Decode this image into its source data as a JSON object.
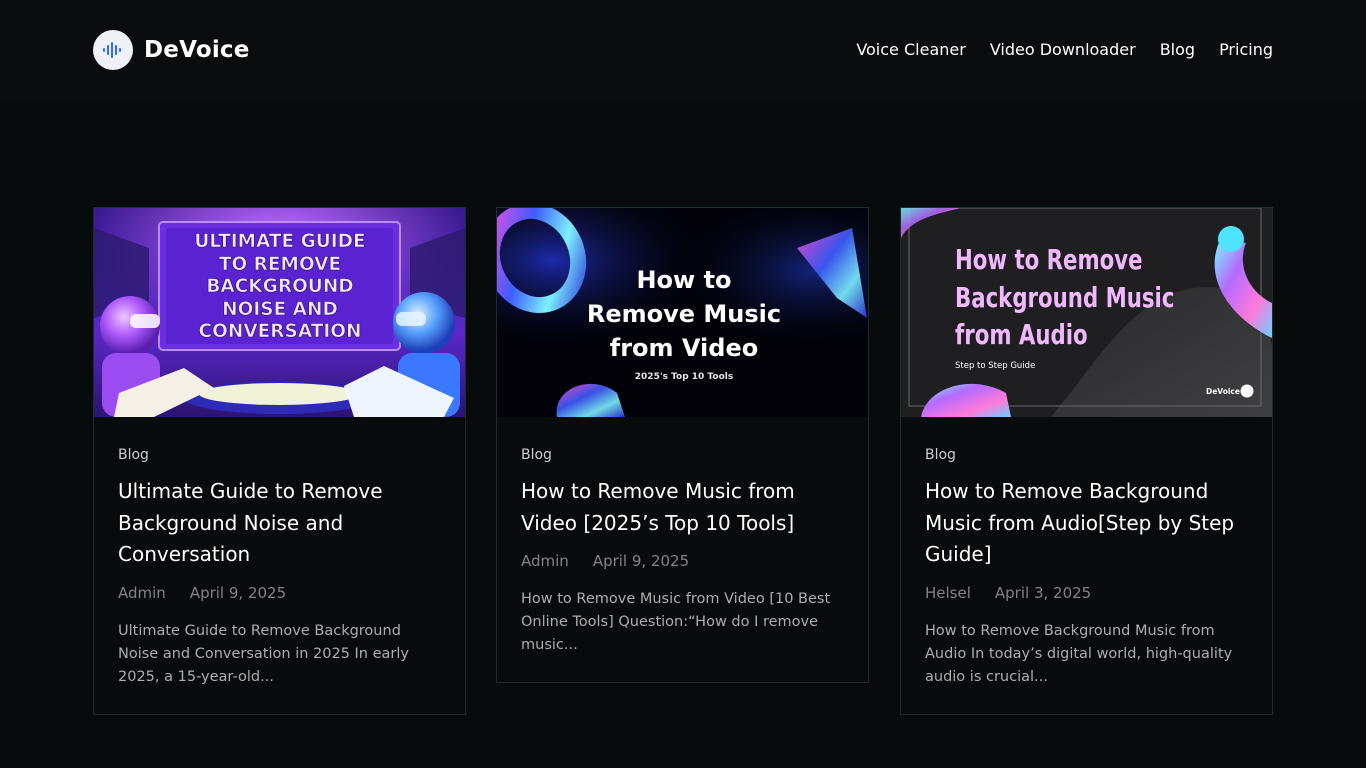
{
  "brand": {
    "name": "DeVoice",
    "accent": "#2f6bff"
  },
  "nav": [
    {
      "label": "Voice Cleaner"
    },
    {
      "label": "Video Downloader"
    },
    {
      "label": "Blog"
    },
    {
      "label": "Pricing"
    }
  ],
  "posts": [
    {
      "category": "Blog",
      "title": "Ultimate Guide to Remove Background Noise and Conversation",
      "author": "Admin",
      "date": "April 9, 2025",
      "excerpt": "Ultimate Guide to Remove Background Noise and Conversation in 2025 In early 2025, a 15-year-old...",
      "thumb": {
        "lines": [
          "ULTIMATE GUIDE",
          "TO REMOVE",
          "BACKGROUND",
          "NOISE AND",
          "CONVERSATION"
        ]
      }
    },
    {
      "category": "Blog",
      "title": "How to Remove Music from Video [2025’s Top 10 Tools]",
      "author": "Admin",
      "date": "April 9, 2025",
      "excerpt": "How to Remove Music from Video [10 Best Online Tools] Question:“How do I remove music...",
      "thumb": {
        "lines": [
          "How to",
          "Remove Music",
          "from Video"
        ],
        "sub": "2025's Top 10 Tools"
      }
    },
    {
      "category": "Blog",
      "title": "How to Remove Background Music from Audio[Step by Step Guide]",
      "author": "Helsel",
      "date": "April 3, 2025",
      "excerpt": "How to Remove Background Music from Audio In today’s digital world, high-quality audio is crucial...",
      "thumb": {
        "lines": [
          "How to Remove",
          "Background Music",
          "from Audio"
        ],
        "sub": "Step to Step Guide",
        "brand": "DeVoice"
      }
    }
  ]
}
